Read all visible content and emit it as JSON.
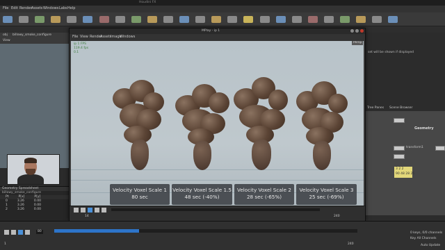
{
  "app": {
    "menu": [
      "File",
      "Edit",
      "Render",
      "Assets",
      "Windows",
      "Labs",
      "Help"
    ]
  },
  "mplay": {
    "title": "MPlay - ip 1",
    "menu": [
      "File",
      "View",
      "Render",
      "Assets",
      "Image",
      "Windows"
    ],
    "display_button": "Persp",
    "info_lines": [
      "ip 1 FPS",
      "119.4 fps",
      "0.1"
    ]
  },
  "labels": [
    {
      "line1": "Velocity Voxel Scale 1",
      "line2": "80 sec"
    },
    {
      "line1": "Velocity Voxel Scale 1.5",
      "line2": "48 sec (-40%)"
    },
    {
      "line1": "Velocity Voxel Scale 2",
      "line2": "28 sec (-65%)"
    },
    {
      "line1": "Velocity Voxel Scale 3",
      "line2": "25 sec (-69%)"
    }
  ],
  "left_pane": {
    "tab": "obj",
    "path": "billowy_smoke_configure",
    "view_label": "View"
  },
  "spreadsheet": {
    "title": "Geometry Spreadsheet",
    "tab": "billowy_smoke_configure",
    "columns": [
      "Pt",
      "P[x]",
      "P[y]"
    ],
    "rows": [
      [
        "0",
        "3.26",
        "0.00"
      ],
      [
        "1",
        "3.26",
        "0.00"
      ],
      [
        "2",
        "3.26",
        "0.00"
      ]
    ]
  },
  "right_pane": {
    "message": "set will be shown if displayed",
    "network_tabs": [
      "Tree Panes",
      "Scene Browser"
    ],
    "geo_label": "Geometry",
    "nodes": [
      "transform1",
      "billowy",
      "filecache"
    ],
    "note_values": [
      "3",
      "2",
      "2",
      "90",
      "48",
      "28",
      "25"
    ]
  },
  "timeline": {
    "frame": "80",
    "start": "1",
    "end": "240",
    "mplay_frame": "14",
    "mplay_end": "240",
    "keys_label": "0 keys, 0/0 channels",
    "key_all": "Key All Channels",
    "auto_update": "Auto Update"
  },
  "colors": {
    "accent": "#2d74c9",
    "smoke": "#5b4435",
    "note": "#e2d77a"
  }
}
